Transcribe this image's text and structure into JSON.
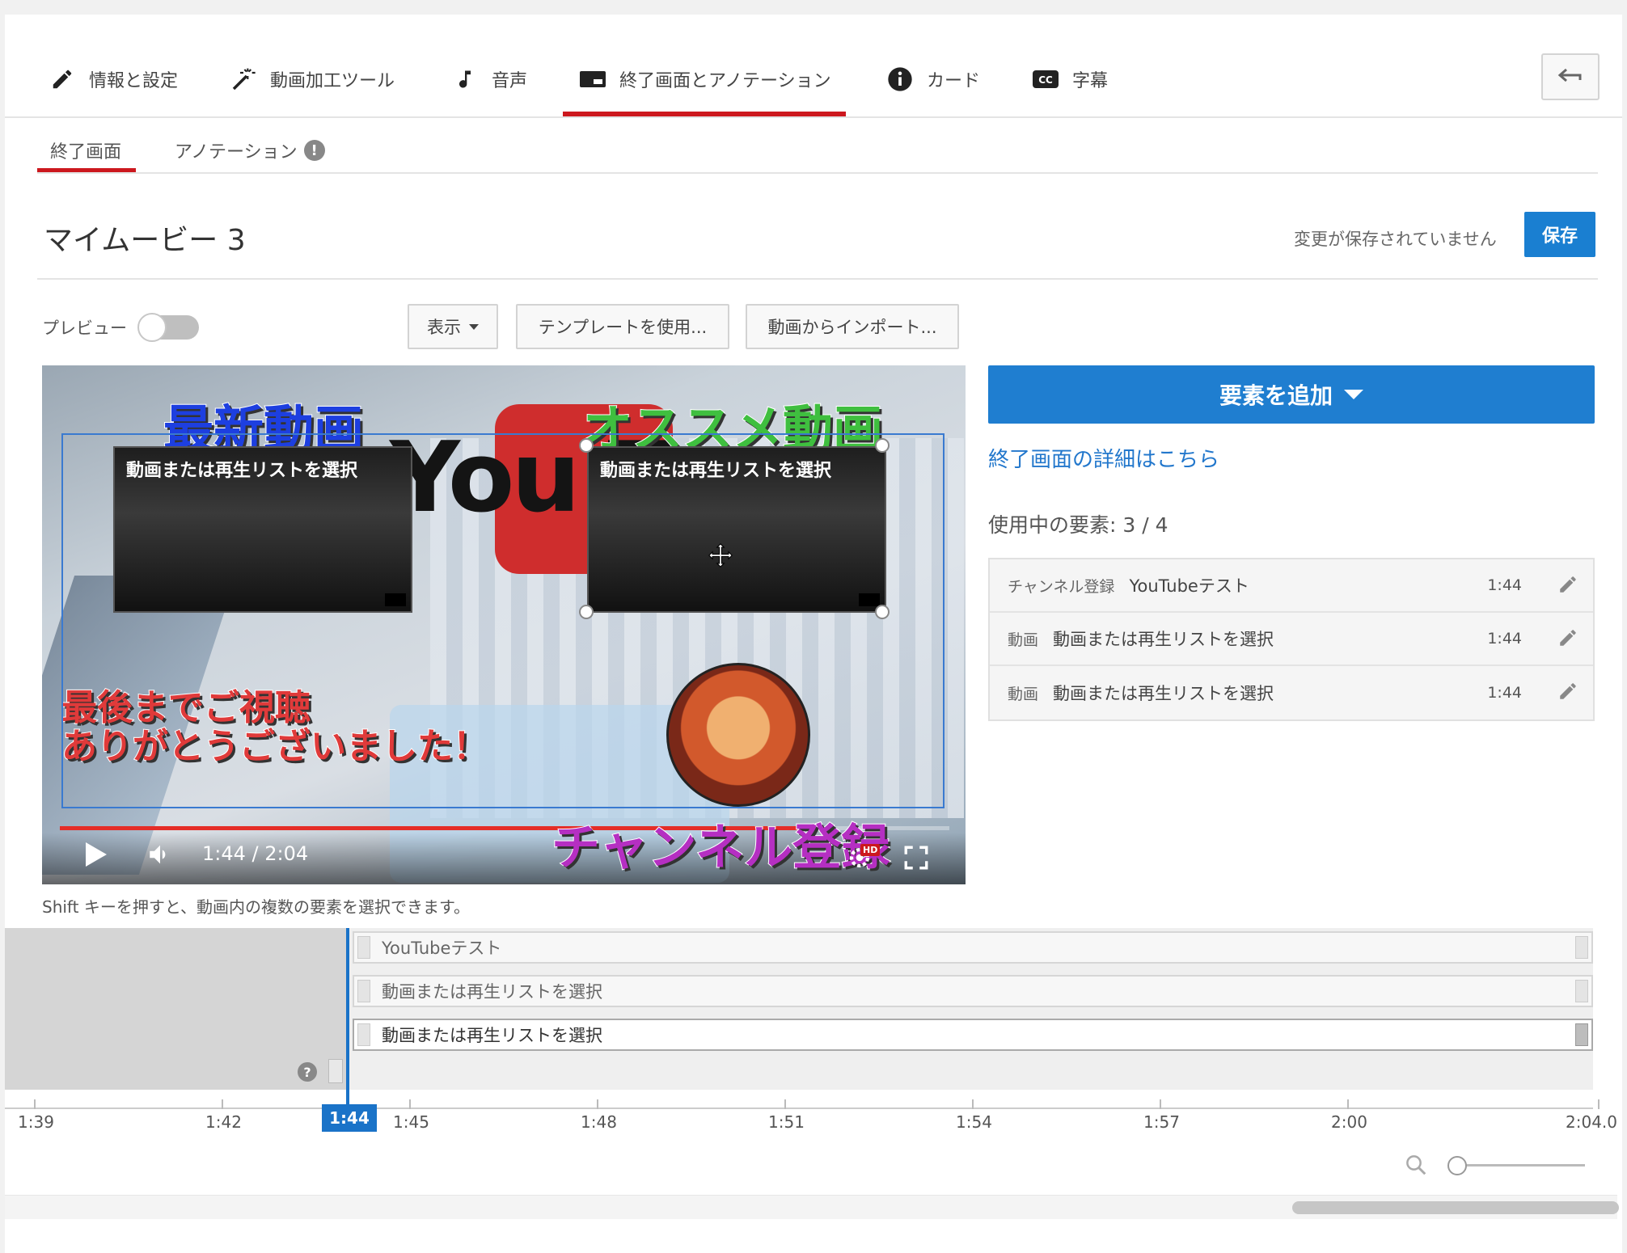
{
  "tabs": [
    {
      "label": "情報と設定",
      "icon": "pencil-icon"
    },
    {
      "label": "動画加工ツール",
      "icon": "magic-wand-icon"
    },
    {
      "label": "音声",
      "icon": "music-note-icon"
    },
    {
      "label": "終了画面とアノテーション",
      "icon": "end-screen-icon",
      "active": true
    },
    {
      "label": "カード",
      "icon": "info-icon"
    },
    {
      "label": "字幕",
      "icon": "cc-icon"
    }
  ],
  "subtabs": [
    {
      "label": "終了画面",
      "active": true
    },
    {
      "label": "アノテーション",
      "icon": "alert-icon"
    }
  ],
  "title": "マイムービー 3",
  "status_text": "変更が保存されていません",
  "save_label": "保存",
  "preview": {
    "label": "プレビュー",
    "on": false
  },
  "toolbar": {
    "display_label": "表示",
    "template_label": "テンプレートを使用...",
    "import_label": "動画からインポート..."
  },
  "video": {
    "headline_new": "最新動画",
    "headline_recommend": "オススメ動画",
    "thanks_line1": "最後までご視聴",
    "thanks_line2": "ありがとうございました！",
    "subscribe_text": "チャンネル登録",
    "logo_text": "You Tu",
    "element1_text": "動画または再生リストを選択",
    "element2_text": "動画または再生リストを選択",
    "timecode": "1:44 / 2:04",
    "progress": 0.84,
    "hd_badge": "HD"
  },
  "shift_hint": "Shift キーを押すと、動画内の複数の要素を選択できます。",
  "add_element_label": "要素を追加",
  "details_link": "終了画面の詳細はこちら",
  "usage_text": "使用中の要素: 3 / 4",
  "elements": [
    {
      "kind": "チャンネル登録",
      "title": "YouTubeテスト",
      "time": "1:44"
    },
    {
      "kind": "動画",
      "title": "動画または再生リストを選択",
      "time": "1:44"
    },
    {
      "kind": "動画",
      "title": "動画または再生リストを選択",
      "time": "1:44"
    }
  ],
  "timeline": {
    "tracks": [
      "YouTubeテスト",
      "動画または再生リストを選択",
      "動画または再生リストを選択"
    ],
    "ticks": [
      "1:39",
      "1:42",
      "1:45",
      "1:48",
      "1:51",
      "1:54",
      "1:57",
      "2:00",
      "2:04.0"
    ],
    "current": "1:44",
    "help": "?"
  },
  "colors": {
    "accent": "#cc181e",
    "primary": "#1f7ed0",
    "playhead": "#1a73c8"
  }
}
